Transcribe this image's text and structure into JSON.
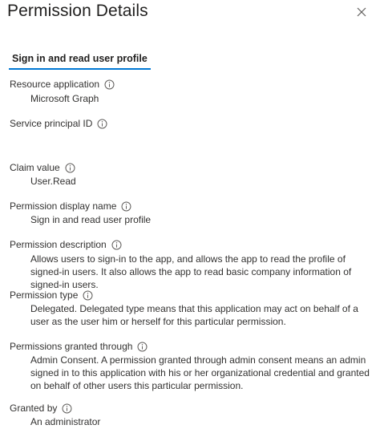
{
  "panel": {
    "title": "Permission Details"
  },
  "tabs": [
    {
      "label": "Sign in and read user profile",
      "selected": true
    }
  ],
  "fields": {
    "resource_application": {
      "label": "Resource application",
      "value": "Microsoft Graph"
    },
    "service_principal_id": {
      "label": "Service principal ID",
      "value": ""
    },
    "claim_value": {
      "label": "Claim value",
      "value": "User.Read"
    },
    "permission_display_name": {
      "label": "Permission display name",
      "value": "Sign in and read user profile"
    },
    "permission_description": {
      "label": "Permission description",
      "value": "Allows users to sign-in to the app, and allows the app to read the profile of signed-in users. It also allows the app to read basic company information of signed-in users."
    },
    "permission_type": {
      "label": "Permission type",
      "value": "Delegated. Delegated type means that this application may act on behalf of a user as the user him or herself for this particular permission."
    },
    "permissions_granted_through": {
      "label": "Permissions granted through",
      "value": "Admin Consent. A permission granted through admin consent means an admin signed in to this application with his or her organizational credential and granted on behalf of other users this particular permission."
    },
    "granted_by": {
      "label": "Granted by",
      "value": "An administrator"
    }
  },
  "icons": {
    "info": "info-icon",
    "close": "close-icon"
  },
  "colors": {
    "accent": "#0078d4",
    "text": "#323130"
  }
}
